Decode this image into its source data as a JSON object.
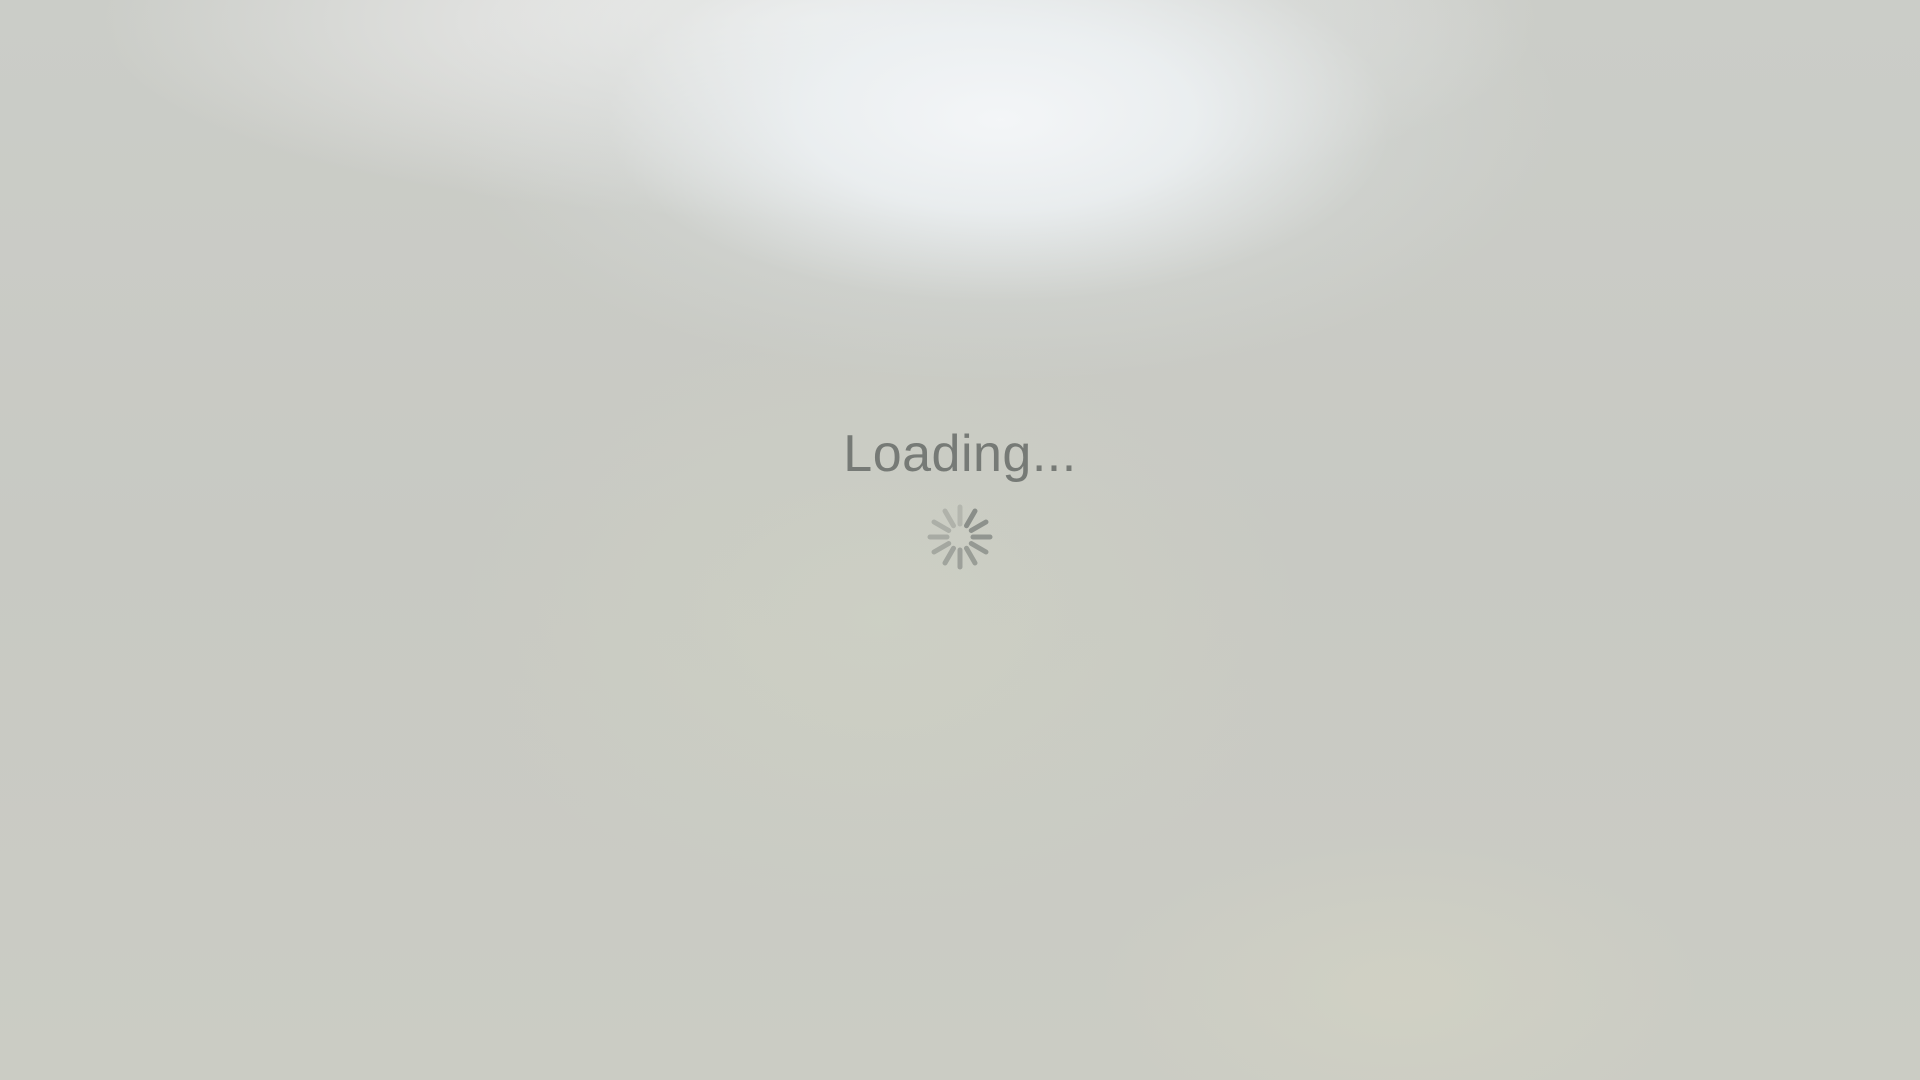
{
  "loading_screen": {
    "message": "Loading...",
    "spinner_icon": "activity-spinner-icon",
    "text_color": "#767a76",
    "spinner_color": "#8a8e89"
  }
}
